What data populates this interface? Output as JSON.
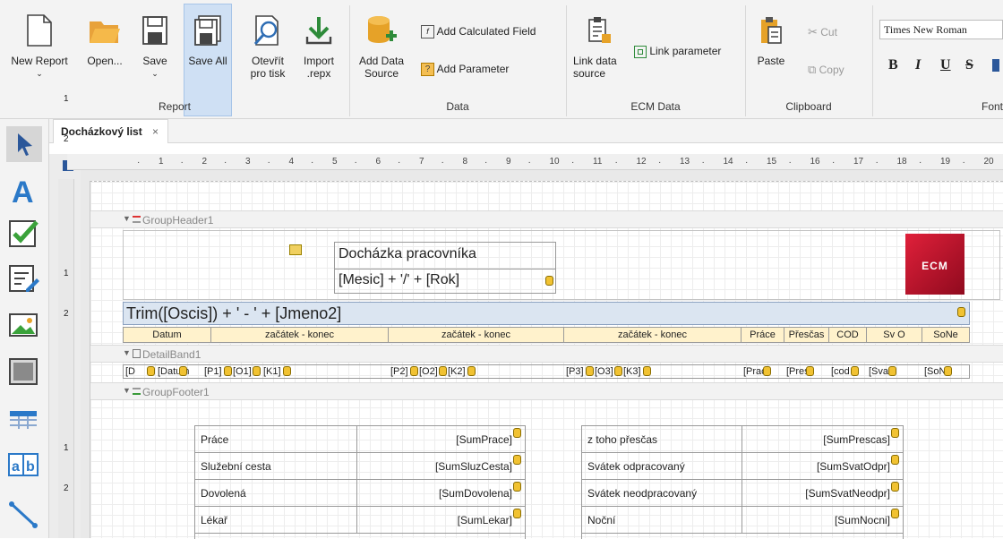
{
  "ribbon": {
    "report": {
      "new_report": "New Report",
      "open": "Open...",
      "save": "Save",
      "save_all": "Save All",
      "otevrit_line1": "Otevřít",
      "otevrit_line2": "pro tisk",
      "import_line1": "Import",
      "import_line2": ".repx",
      "group_label": "Report"
    },
    "data": {
      "add_data_source_line1": "Add Data",
      "add_data_source_line2": "Source",
      "add_calculated_field": "Add Calculated Field",
      "add_parameter": "Add Parameter",
      "group_label": "Data"
    },
    "ecm": {
      "link_data_source_line1": "Link data",
      "link_data_source_line2": "source",
      "link_parameter": "Link parameter",
      "group_label": "ECM Data"
    },
    "clipboard": {
      "paste": "Paste",
      "cut": "Cut",
      "copy": "Copy",
      "group_label": "Clipboard"
    },
    "font": {
      "font_name": "Times New Roman",
      "bold": "B",
      "italic": "I",
      "underline": "U",
      "strike": "S",
      "group_label": "Font"
    }
  },
  "document": {
    "tab_title": "Docházkový list",
    "close_glyph": "×"
  },
  "ruler_numbers": [
    "1",
    "2",
    "3",
    "4",
    "5",
    "6",
    "7",
    "8",
    "9",
    "10",
    "11",
    "12",
    "13",
    "14",
    "15",
    "16",
    "17",
    "18",
    "19",
    "20"
  ],
  "vruler_numbers": [
    "1",
    "2",
    "1",
    "2",
    "1",
    "2"
  ],
  "bands": {
    "group_header": "GroupHeader1",
    "detail": "DetailBand1",
    "group_footer": "GroupFooter1"
  },
  "header": {
    "title": "Docházka pracovníka",
    "subtitle": "[Mesic] + '/' + [Rok]",
    "logo_text": "ECM",
    "name_expr": "Trim([Oscis]) + ' - ' + [Jmeno2]",
    "columns": [
      "Datum",
      "začátek - konec",
      "začátek - konec",
      "začátek - konec",
      "Práce",
      "Přesčas",
      "COD",
      "Sv O",
      "SoNe"
    ]
  },
  "detail_row": [
    "[D",
    "[Datum",
    "[P1]",
    "[O1]",
    "[K1]",
    "[P2]",
    "[O2]",
    "[K2]",
    "[P3]",
    "[O3]",
    "[K3]",
    "[Prac",
    "[Presc",
    "[cod",
    "[Svat",
    "[SoN"
  ],
  "footer": {
    "left": [
      {
        "label": "Práce",
        "value": "[SumPrace]"
      },
      {
        "label": "Služební cesta",
        "value": "[SumSluzCesta]"
      },
      {
        "label": "Dovolená",
        "value": "[SumDovolena]"
      },
      {
        "label": "Lékař",
        "value": "[SumLekar]"
      }
    ],
    "right": [
      {
        "label": "z toho přesčas",
        "value": "[SumPrescas]"
      },
      {
        "label": "Svátek odpracovaný",
        "value": "[SumSvatOdpr]"
      },
      {
        "label": "Svátek neodpracovaný",
        "value": "[SumSvatNeodpr]"
      },
      {
        "label": "Noční",
        "value": "[SumNocni]"
      }
    ]
  },
  "toolbox": [
    "pointer-icon",
    "label-icon",
    "checkbox-icon",
    "richtext-icon",
    "picture-icon",
    "panel-icon",
    "table-icon",
    "characterbox-icon",
    "line-icon"
  ],
  "colors": {
    "accent": "#2b579a",
    "logo_red": "#c8102e",
    "name_band": "#dbe5f1",
    "header_row": "#fff2cc"
  }
}
